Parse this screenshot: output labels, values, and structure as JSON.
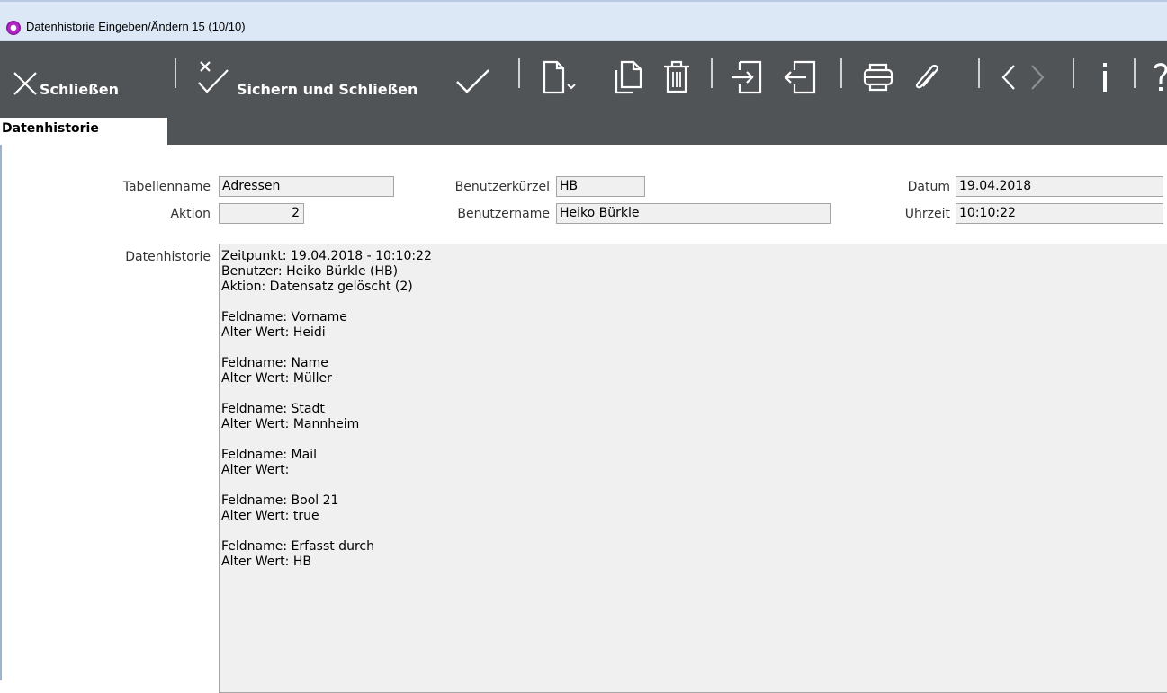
{
  "window": {
    "title": "Datenhistorie Eingeben/Ändern 15 (10/10)"
  },
  "toolbar": {
    "close_label": "Schließen",
    "save_close_label": "Sichern und Schließen",
    "icon_color": "#ffffff",
    "background": "#515457"
  },
  "tabs": {
    "active_label": "Datenhistorie"
  },
  "form": {
    "tabellenname_label": "Tabellenname",
    "tabellenname_value": "Adressen",
    "aktion_label": "Aktion",
    "aktion_value": "2",
    "benutzerkuerzel_label": "Benutzerkürzel",
    "benutzerkuerzel_value": "HB",
    "benutzername_label": "Benutzername",
    "benutzername_value": "Heiko Bürkle",
    "datum_label": "Datum",
    "datum_value": "19.04.2018",
    "uhrzeit_label": "Uhrzeit",
    "uhrzeit_value": "10:10:22",
    "datenhistorie_label": "Datenhistorie"
  },
  "history": {
    "line1": "Zeitpunkt: 19.04.2018 - 10:10:22",
    "line2": "Benutzer: Heiko Bürkle (HB)",
    "line3": "Aktion: Datensatz gelöscht (2)",
    "fields": [
      {
        "name": "Feldname: Vorname",
        "old": "Alter Wert: Heidi"
      },
      {
        "name": "Feldname: Name",
        "old": "Alter Wert: Müller"
      },
      {
        "name": "Feldname: Stadt",
        "old": "Alter Wert: Mannheim"
      },
      {
        "name": "Feldname: Mail",
        "old": "Alter Wert:"
      },
      {
        "name": "Feldname: Bool 21",
        "old": "Alter Wert: true"
      },
      {
        "name": "Feldname: Erfasst durch",
        "old": "Alter Wert: HB"
      }
    ]
  }
}
